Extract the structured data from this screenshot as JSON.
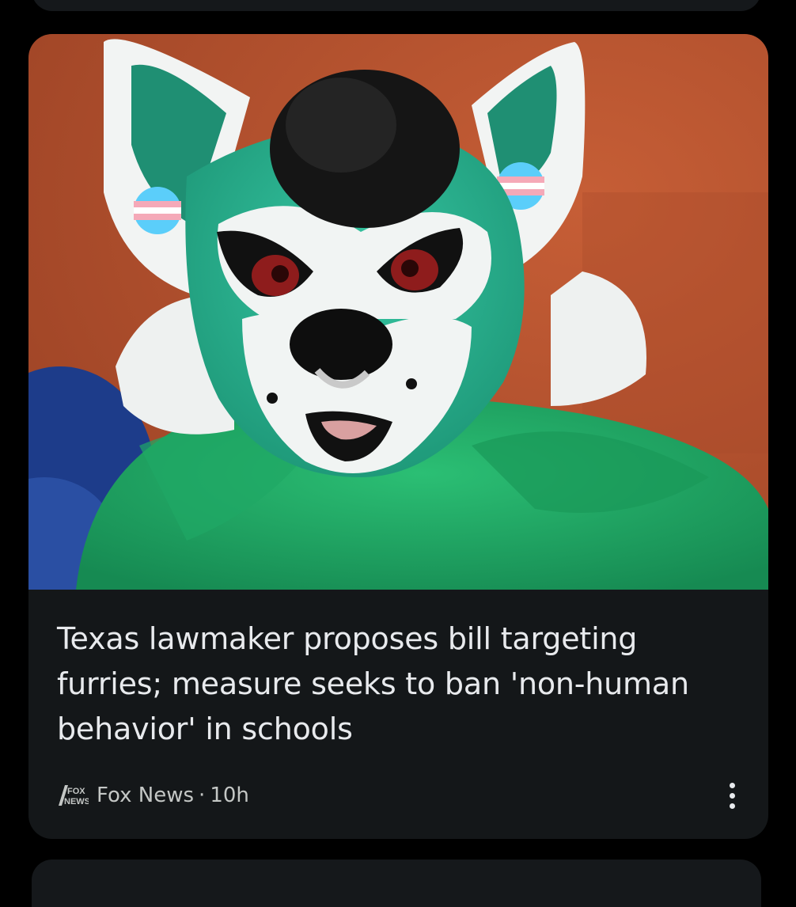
{
  "article": {
    "headline": "Texas lawmaker proposes bill targeting furries; measure seeks to ban 'non-human behavior' in schools",
    "source": "Fox News",
    "separator": "·",
    "time": "10h",
    "source_logo_text": [
      "FOX",
      "NEWS"
    ],
    "image_alt": "Person in a green and white wolf fursuit costume"
  },
  "colors": {
    "card_background": "#141719",
    "headline_text": "#e8eaed",
    "meta_text": "#c4c7c5",
    "fur_green": "#1fae6a",
    "fur_teal": "#2fb89a",
    "brick_wall": "#b5532f"
  },
  "icons": {
    "more": "more-vert-icon",
    "source": "fox-news-logo"
  }
}
